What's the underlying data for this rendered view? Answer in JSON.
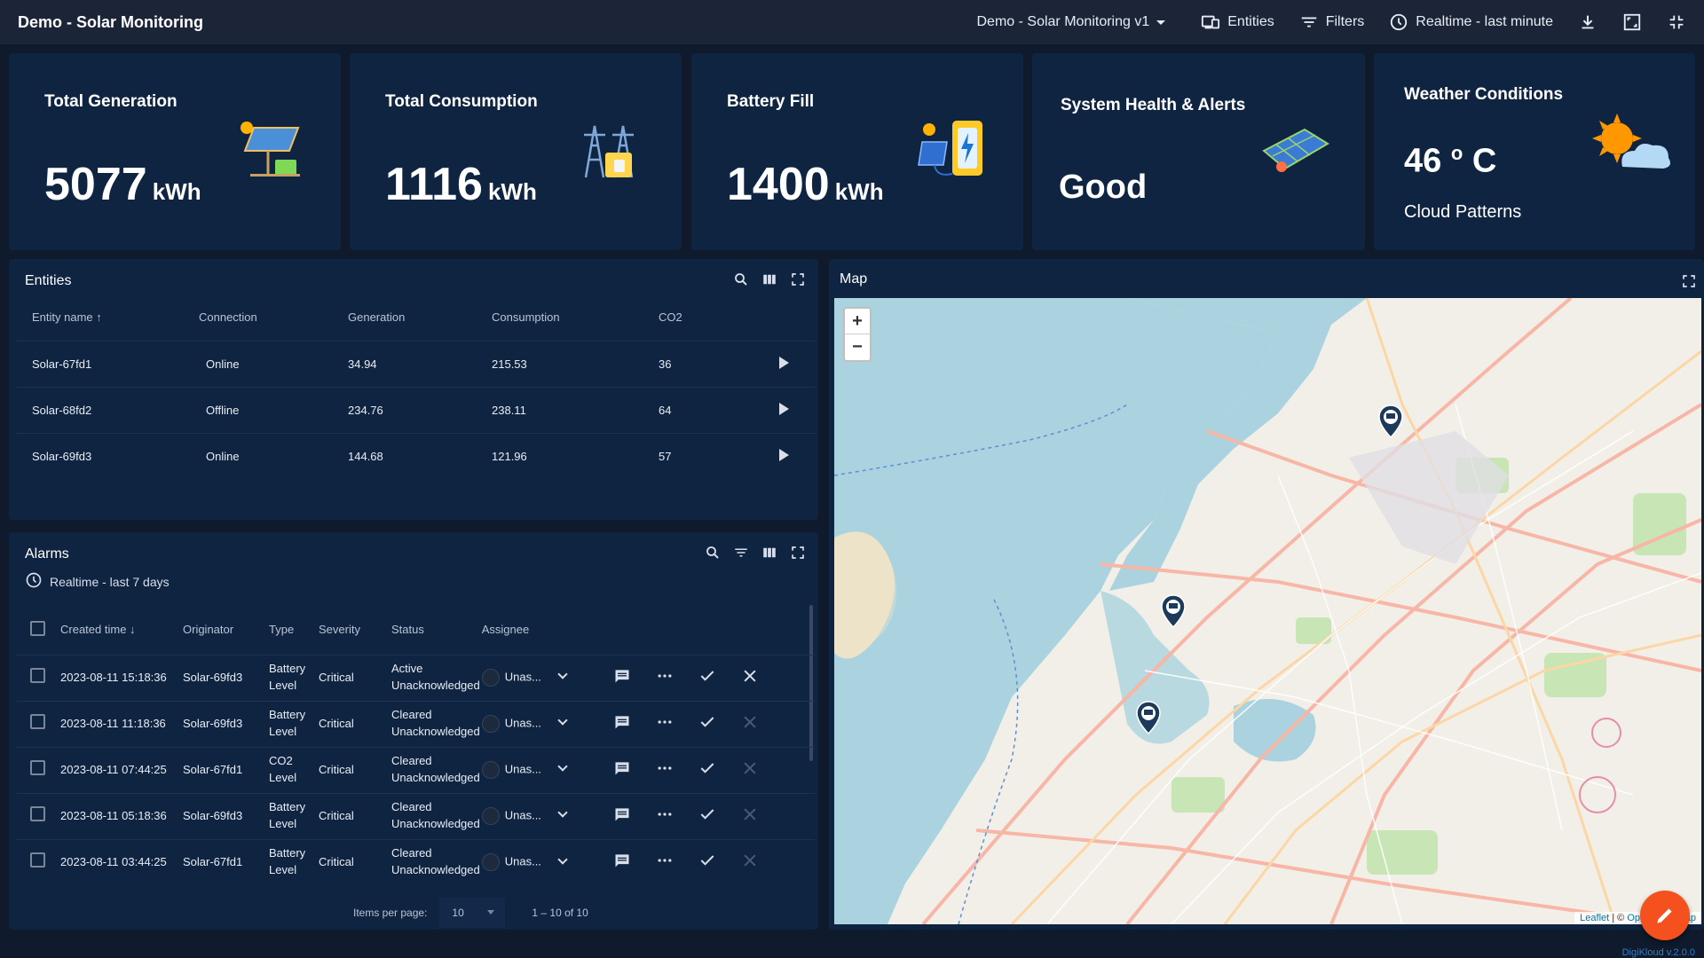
{
  "header": {
    "title": "Demo - Solar Monitoring",
    "dashboard_select": "Demo - Solar Monitoring v1",
    "entities_label": "Entities",
    "filters_label": "Filters",
    "timewindow_label": "Realtime - last minute"
  },
  "cards": {
    "generation": {
      "title": "Total Generation",
      "value": "5077",
      "unit": "kWh"
    },
    "consumption": {
      "title": "Total Consumption",
      "value": "1116",
      "unit": "kWh"
    },
    "battery": {
      "title": "Battery Fill",
      "value": "1400",
      "unit": "kWh"
    },
    "health": {
      "title": "System Health & Alerts",
      "value": "Good"
    },
    "weather": {
      "title": "Weather Conditions",
      "temperature": "46",
      "degree": "o",
      "unit": "C",
      "description": "Cloud Patterns"
    }
  },
  "entities": {
    "title": "Entities",
    "columns": [
      "Entity name",
      "Connection",
      "Generation",
      "Consumption",
      "CO2"
    ],
    "rows": [
      {
        "name": "Solar-67fd1",
        "connection": "Online",
        "generation": "34.94",
        "consumption": "215.53",
        "co2": "36"
      },
      {
        "name": "Solar-68fd2",
        "connection": "Offline",
        "generation": "234.76",
        "consumption": "238.11",
        "co2": "64"
      },
      {
        "name": "Solar-69fd3",
        "connection": "Online",
        "generation": "144.68",
        "consumption": "121.96",
        "co2": "57"
      }
    ]
  },
  "alarms": {
    "title": "Alarms",
    "timewindow": "Realtime - last 7 days",
    "columns": [
      "Created time",
      "Originator",
      "Type",
      "Severity",
      "Status",
      "Assignee"
    ],
    "rows": [
      {
        "time": "2023-08-11 15:18:36",
        "originator": "Solar-69fd3",
        "type1": "Battery",
        "type2": "Level",
        "severity": "Critical",
        "status1": "Active",
        "status2": "Unacknowledged",
        "assignee": "Unas..."
      },
      {
        "time": "2023-08-11 11:18:36",
        "originator": "Solar-69fd3",
        "type1": "Battery",
        "type2": "Level",
        "severity": "Critical",
        "status1": "Cleared",
        "status2": "Unacknowledged",
        "assignee": "Unas..."
      },
      {
        "time": "2023-08-11 07:44:25",
        "originator": "Solar-67fd1",
        "type1": "CO2",
        "type2": "Level",
        "severity": "Critical",
        "status1": "Cleared",
        "status2": "Unacknowledged",
        "assignee": "Unas..."
      },
      {
        "time": "2023-08-11 05:18:36",
        "originator": "Solar-69fd3",
        "type1": "Battery",
        "type2": "Level",
        "severity": "Critical",
        "status1": "Cleared",
        "status2": "Unacknowledged",
        "assignee": "Unas..."
      },
      {
        "time": "2023-08-11 03:44:25",
        "originator": "Solar-67fd1",
        "type1": "Battery",
        "type2": "Level",
        "severity": "Critical",
        "status1": "Cleared",
        "status2": "Unacknowledged",
        "assignee": "Unas..."
      }
    ],
    "items_per_page_label": "Items per page:",
    "items_per_page": "10",
    "range": "1 – 10 of 10"
  },
  "map": {
    "title": "Map",
    "zoom_in": "+",
    "zoom_out": "−",
    "attribution_leaflet": "Leaflet",
    "attribution_sep": " | © ",
    "attribution_osm": "OpenStreetMap"
  },
  "version": "DigiKloud v.2.0.0",
  "colors": {
    "background": "#0f1a2c",
    "card": "#0f2440",
    "online": "#4caf50",
    "critical": "#e53935",
    "fab": "#f4511e"
  }
}
